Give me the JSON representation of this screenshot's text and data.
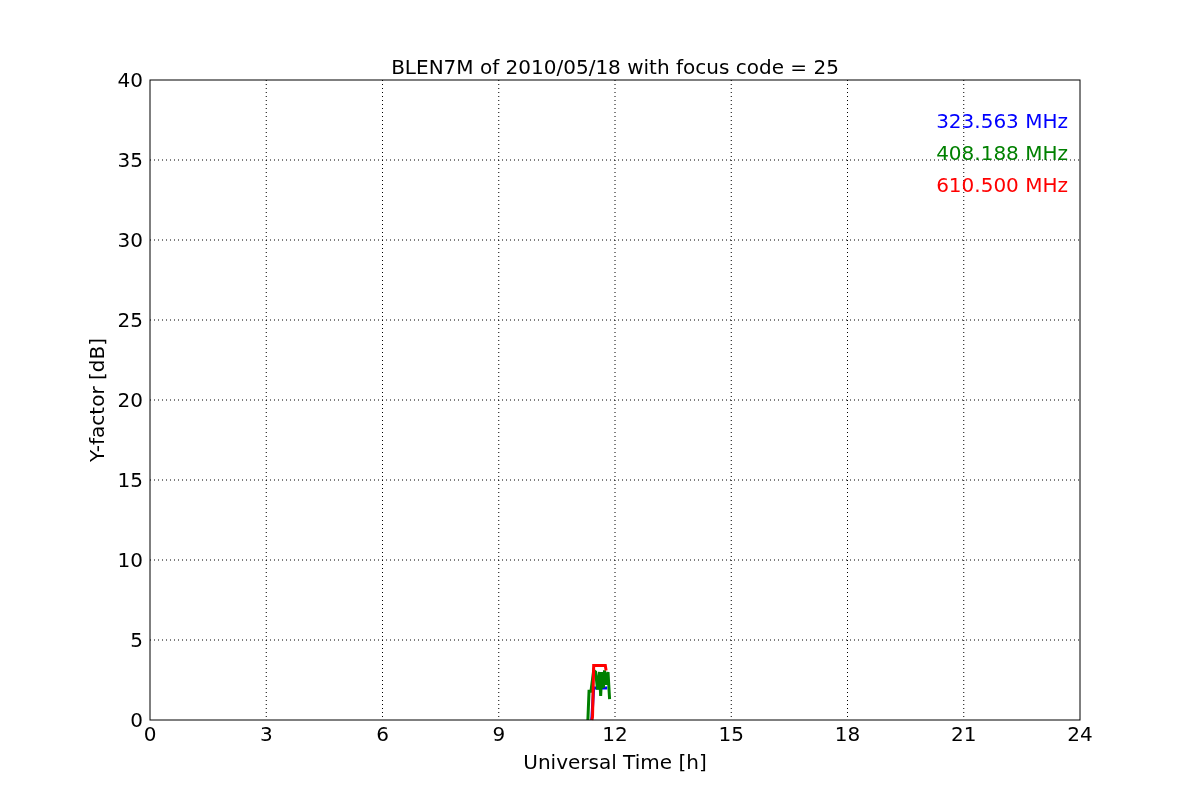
{
  "figure": {
    "chart_data": {
      "type": "line",
      "grid": true,
      "title": "BLEN7M of 2010/05/18 with focus code = 25",
      "xlabel": "Universal Time [h]",
      "ylabel": "Y-factor [dB]",
      "xlim": [
        0,
        24
      ],
      "ylim": [
        0,
        40
      ],
      "xticks": [
        0,
        3,
        6,
        9,
        12,
        15,
        18,
        21,
        24
      ],
      "yticks": [
        0,
        5,
        10,
        15,
        20,
        25,
        30,
        35,
        40
      ],
      "series": [
        {
          "name": "323.563 MHz",
          "color": "#0000ff",
          "x": [
            11.4,
            11.45,
            11.6,
            11.8
          ],
          "values": [
            0,
            2.0,
            2.0,
            2.0
          ]
        },
        {
          "name": "408.188 MHz",
          "color": "#008000",
          "x": [
            11.3,
            11.33,
            11.38,
            11.45,
            11.5,
            11.55,
            11.6,
            11.63,
            11.66,
            11.7,
            11.73,
            11.76,
            11.82,
            11.86
          ],
          "values": [
            0,
            1.8,
            1.8,
            3.1,
            3.0,
            1.9,
            3.0,
            1.5,
            3.0,
            2.0,
            3.1,
            2.2,
            3.0,
            1.3
          ]
        },
        {
          "name": "610.500 MHz",
          "color": "#ff0000",
          "x": [
            11.4,
            11.42,
            11.45,
            11.6,
            11.75,
            11.77
          ],
          "values": [
            0,
            0.2,
            3.4,
            3.4,
            3.4,
            3.1
          ]
        }
      ]
    }
  }
}
